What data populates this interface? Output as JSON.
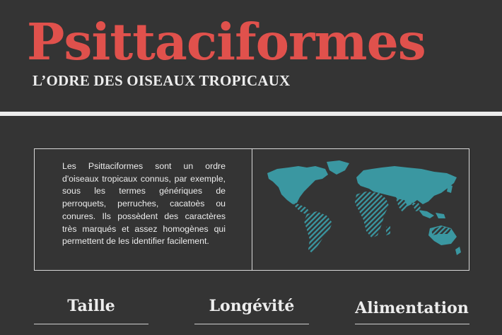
{
  "header": {
    "title": "Psittaciformes",
    "subtitle": "L’ODRE DES OISEAUX TROPICAUX"
  },
  "intro": {
    "text": "Les Psittaciformes sont un ordre d'oiseaux tropicaux connus, par exemple, sous les termes génériques de perroquets, perruches, cacatoès ou conures. Ils possèdent des caractères très marqués et assez homogènes qui permettent de les identifier facilement."
  },
  "map": {
    "icon": "world-map-icon",
    "land_color": "#3a97a1",
    "highlight_pattern": "diagonal-stripes"
  },
  "stats": {
    "headings": [
      "Taille",
      "Longévité",
      "Alimentation"
    ]
  },
  "colors": {
    "background": "#343434",
    "accent": "#e0514c",
    "text": "#ededed",
    "map": "#3a97a1"
  }
}
